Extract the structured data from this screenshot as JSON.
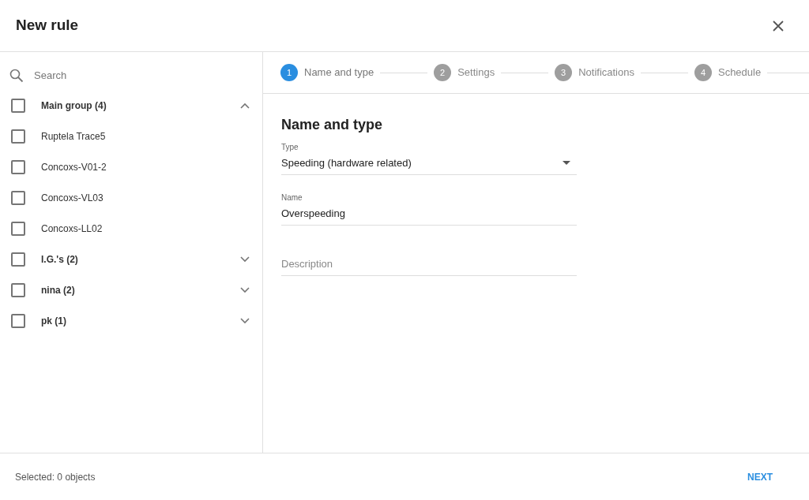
{
  "dialog": {
    "title": "New rule"
  },
  "sidebar": {
    "search": {
      "placeholder": "Search"
    },
    "tree": [
      {
        "label": "Main group (4)",
        "kind": "group",
        "checked": false,
        "expanded": true,
        "children": [
          {
            "label": "Ruptela Trace5",
            "kind": "object",
            "checked": false
          },
          {
            "label": "Concoxs-V01-2",
            "kind": "object",
            "checked": false
          },
          {
            "label": "Concoxs-VL03",
            "kind": "object",
            "checked": false
          },
          {
            "label": "Concoxs-LL02",
            "kind": "object",
            "checked": false
          }
        ]
      },
      {
        "label": "I.G.'s (2)",
        "kind": "group",
        "checked": false,
        "expanded": false
      },
      {
        "label": "nina (2)",
        "kind": "group",
        "checked": false,
        "expanded": false
      },
      {
        "label": "pk (1)",
        "kind": "group",
        "checked": false,
        "expanded": false
      }
    ]
  },
  "stepper": [
    {
      "number": "1",
      "label": "Name and type",
      "selected": true
    },
    {
      "number": "2",
      "label": "Settings",
      "selected": false
    },
    {
      "number": "3",
      "label": "Notifications",
      "selected": false
    },
    {
      "number": "4",
      "label": "Schedule",
      "selected": false
    }
  ],
  "form": {
    "heading": "Name and type",
    "fields": [
      {
        "kind": "select",
        "label": "Type",
        "value": "Speeding (hardware related)"
      },
      {
        "kind": "text",
        "label": "Name",
        "value": "Overspeeding"
      },
      {
        "kind": "text",
        "placeholder": "Description"
      }
    ]
  },
  "footer": {
    "status": "Selected: 0 objects",
    "button": "NEXT"
  }
}
